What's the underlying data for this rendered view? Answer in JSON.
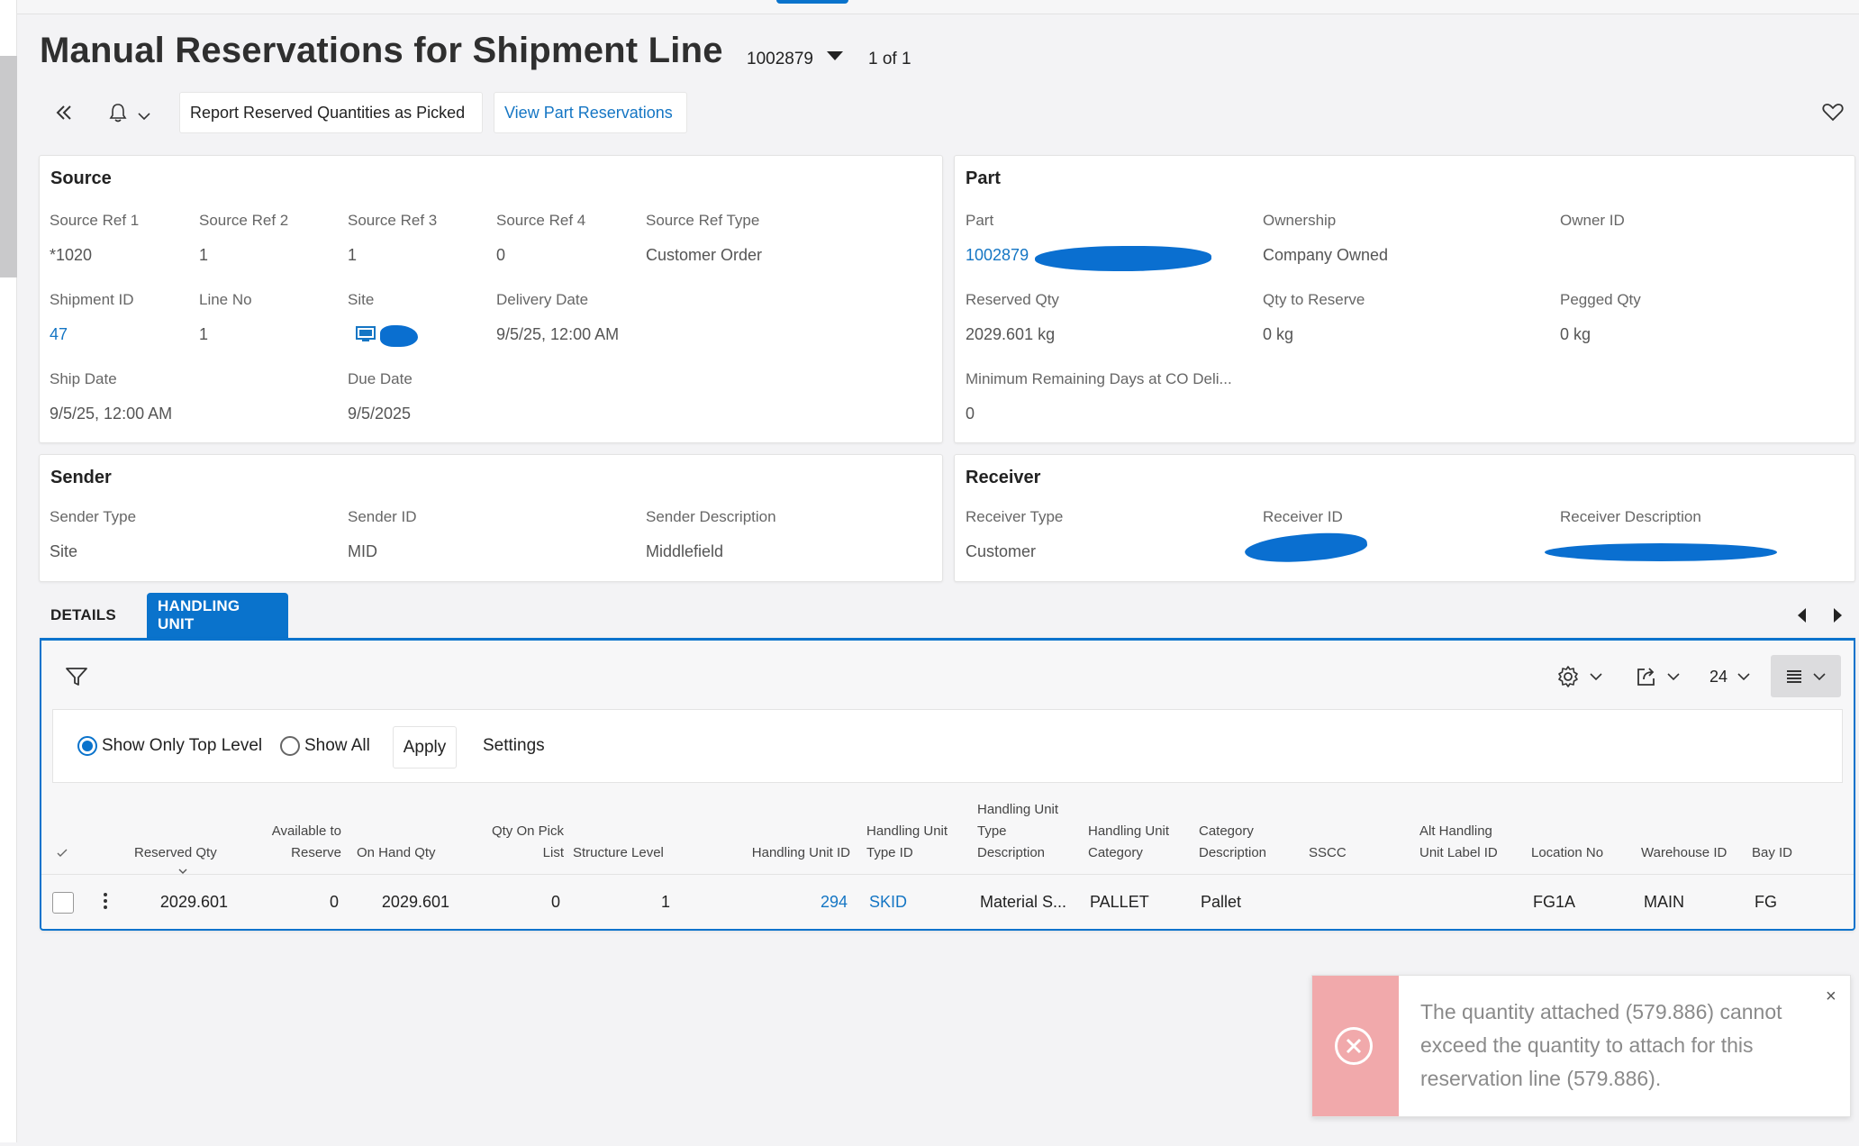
{
  "page": {
    "title": "Manual Reservations for Shipment Line",
    "record_number": "1002879",
    "pager": "1 of 1"
  },
  "toolbar": {
    "report_label": "Report Reserved Quantities as Picked",
    "view_label": "View Part Reservations"
  },
  "source": {
    "title": "Source",
    "fields": [
      {
        "label": "Source Ref 1",
        "value": "*1020"
      },
      {
        "label": "Source Ref 2",
        "value": "1"
      },
      {
        "label": "Source Ref 3",
        "value": "1"
      },
      {
        "label": "Source Ref 4",
        "value": "0"
      },
      {
        "label": "Source Ref Type",
        "value": "Customer Order"
      },
      {
        "label": "Shipment ID",
        "value": "47"
      },
      {
        "label": "Line No",
        "value": "1"
      },
      {
        "label": "Site",
        "value": ""
      },
      {
        "label": "Delivery Date",
        "value": "9/5/25, 12:00 AM"
      },
      {
        "label": "Ship Date",
        "value": "9/5/25, 12:00 AM"
      },
      {
        "label": "Due Date",
        "value": "9/5/2025"
      }
    ]
  },
  "part": {
    "title": "Part",
    "fields": [
      {
        "label": "Part",
        "value": "1002879"
      },
      {
        "label": "Ownership",
        "value": "Company Owned"
      },
      {
        "label": "Owner ID",
        "value": ""
      },
      {
        "label": "Reserved Qty",
        "value": "2029.601 kg"
      },
      {
        "label": "Qty to Reserve",
        "value": "0 kg"
      },
      {
        "label": "Pegged Qty",
        "value": "0 kg"
      },
      {
        "label": "Minimum Remaining Days at CO Deli...",
        "value": "0"
      }
    ]
  },
  "sender": {
    "title": "Sender",
    "fields": [
      {
        "label": "Sender Type",
        "value": "Site"
      },
      {
        "label": "Sender ID",
        "value": "MID"
      },
      {
        "label": "Sender Description",
        "value": "Middlefield"
      }
    ]
  },
  "receiver": {
    "title": "Receiver",
    "fields": [
      {
        "label": "Receiver Type",
        "value": "Customer"
      },
      {
        "label": "Receiver ID",
        "value": ""
      },
      {
        "label": "Receiver Description",
        "value": ""
      }
    ]
  },
  "tabs": [
    {
      "label": "DETAILS",
      "active": false
    },
    {
      "label": "HANDLING UNIT",
      "active": true
    }
  ],
  "grid_toolbar": {
    "page_size": "24"
  },
  "filter": {
    "option_top": "Show Only Top Level",
    "option_all": "Show All",
    "selected": "Show Only Top Level",
    "apply_label": "Apply",
    "settings_label": "Settings"
  },
  "table": {
    "columns": [
      {
        "line1": "",
        "line2": "",
        "line3": "Reserved Qty"
      },
      {
        "line1": "",
        "line2": "Available to",
        "line3": "Reserve"
      },
      {
        "line1": "",
        "line2": "",
        "line3": "On Hand Qty"
      },
      {
        "line1": "",
        "line2": "Qty On Pick",
        "line3": "List"
      },
      {
        "line1": "",
        "line2": "",
        "line3": "Structure Level"
      },
      {
        "line1": "",
        "line2": "",
        "line3": "Handling Unit ID"
      },
      {
        "line1": "",
        "line2": "Handling Unit",
        "line3": "Type ID"
      },
      {
        "line1": "Handling Unit",
        "line2": "Type",
        "line3": "Description"
      },
      {
        "line1": "",
        "line2": "Handling Unit",
        "line3": "Category"
      },
      {
        "line1": "",
        "line2": "Category",
        "line3": "Description"
      },
      {
        "line1": "",
        "line2": "",
        "line3": "SSCC"
      },
      {
        "line1": "",
        "line2": "Alt Handling",
        "line3": "Unit Label ID"
      },
      {
        "line1": "",
        "line2": "",
        "line3": "Location No"
      },
      {
        "line1": "",
        "line2": "",
        "line3": "Warehouse ID"
      },
      {
        "line1": "",
        "line2": "",
        "line3": "Bay ID"
      }
    ],
    "rows": [
      [
        "2029.601",
        "0",
        "2029.601",
        "0",
        "1",
        "294",
        "SKID",
        "Material S...",
        "PALLET",
        "Pallet",
        "",
        "",
        "FG1A",
        "MAIN",
        "FG"
      ]
    ]
  },
  "toast": {
    "message": "The quantity attached (579.886) cannot exceed the quantity to attach for this reservation line (579.886).",
    "close": "×"
  },
  "colors": {
    "accent": "#0a73cc",
    "link": "#1576c4",
    "error": "#f1a9ab"
  }
}
